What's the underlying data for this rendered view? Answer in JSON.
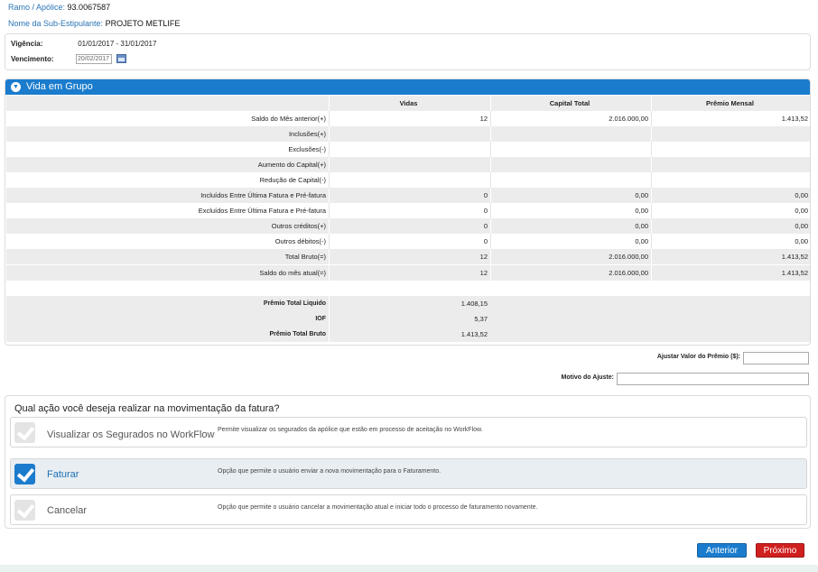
{
  "header": {
    "ramo_label": "Ramo / Apólice:",
    "ramo_value": "93.0067587",
    "sub_label": "Nome da Sub-Estipulante:",
    "sub_value": "PROJETO METLIFE"
  },
  "vigencia": {
    "label": "Vigência:",
    "value": "01/01/2017 - 31/01/2017",
    "venc_label": "Vencimento:",
    "venc_value": "20/02/2017"
  },
  "group": {
    "title": "Vida em Grupo",
    "columns": [
      "",
      "Vidas",
      "Capital Total",
      "Prêmio Mensal"
    ],
    "rows": [
      {
        "label": "Saldo do Mês anterior(+)",
        "vidas": "12",
        "capital": "2.016.000,00",
        "premio": "1.413,52"
      },
      {
        "label": "Inclusões(+)",
        "vidas": "",
        "capital": "",
        "premio": ""
      },
      {
        "label": "Exclusões(-)",
        "vidas": "",
        "capital": "",
        "premio": ""
      },
      {
        "label": "Aumento do Capital(+)",
        "vidas": "",
        "capital": "",
        "premio": ""
      },
      {
        "label": "Redução de Capital(-)",
        "vidas": "",
        "capital": "",
        "premio": ""
      },
      {
        "label": "Incluídos Entre Última Fatura e Pré-fatura",
        "vidas": "0",
        "capital": "0,00",
        "premio": "0,00"
      },
      {
        "label": "Excluídos Entre Última Fatura e Pré-fatura",
        "vidas": "0",
        "capital": "0,00",
        "premio": "0,00"
      },
      {
        "label": "Outros créditos(+)",
        "vidas": "0",
        "capital": "0,00",
        "premio": "0,00"
      },
      {
        "label": "Outros débitos(-)",
        "vidas": "0",
        "capital": "0,00",
        "premio": "0,00"
      },
      {
        "label": "Total Bruto(=)",
        "vidas": "12",
        "capital": "2.016.000,00",
        "premio": "1.413,52"
      },
      {
        "label": "Saldo do mês atual(=)",
        "vidas": "12",
        "capital": "2.016.000,00",
        "premio": "1.413,52"
      }
    ],
    "summary": [
      {
        "label": "Prêmio Total Liquido",
        "value": "1.408,15"
      },
      {
        "label": "IOF",
        "value": "5,37"
      },
      {
        "label": "Prêmio Total Bruto",
        "value": "1.413,52"
      }
    ]
  },
  "adjust": {
    "value_label": "Ajustar Valor do Prêmio ($):",
    "reason_label": "Motivo do Ajuste:"
  },
  "actions": {
    "question": "Qual ação você deseja realizar na movimentação da fatura?",
    "options": [
      {
        "label": "Visualizar os Segurados no WorkFlow",
        "desc": "Permite visualizar os segurados da apólice que estão em processo de aceitação no WorkFlow.",
        "selected": false
      },
      {
        "label": "Faturar",
        "desc": "Opção que permite o usuário enviar a nova movimentação para o Faturamento.",
        "selected": true
      },
      {
        "label": "Cancelar",
        "desc": "Opção que permite o usuário cancelar a movimentação atual e iniciar todo o processo de faturamento novamente.",
        "selected": false
      }
    ]
  },
  "buttons": {
    "prev": "Anterior",
    "next": "Próximo"
  },
  "colors": {
    "accent": "#1b7ccd",
    "danger": "#d01f1f"
  }
}
